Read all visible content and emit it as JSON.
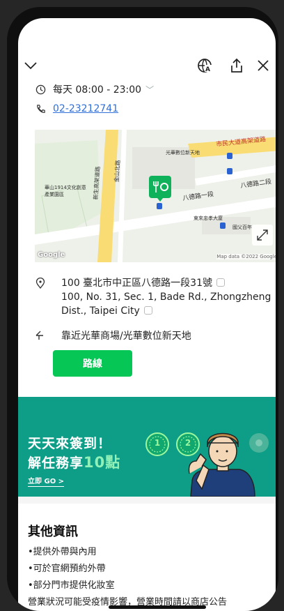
{
  "hours": {
    "label": "每天 08:00 - 23:00"
  },
  "phone": {
    "number": "02-23212741"
  },
  "map": {
    "attribution": "Map data ©2022 Google",
    "google": "Google",
    "labels": {
      "building": "光華數位新天地",
      "park": "華山1914文化創意產業園區",
      "road1": "八德路一段",
      "road2": "八德路二段",
      "ring": "市民大道高架道路",
      "east_st": "東來忠孝大廈",
      "memorial": "國父百年",
      "v_road1": "新生高架道路",
      "v_road2": "金山北路"
    }
  },
  "address": {
    "zh": "100 臺北市中正區八德路一段31號",
    "en": "100, No. 31, Sec. 1, Bade Rd., Zhongzheng Dist., Taipei City"
  },
  "nearby": {
    "text": "靠近光華商場/光華數位新天地"
  },
  "route_button": {
    "label": "路線"
  },
  "banner": {
    "line1": "天天來簽到！",
    "line2_prefix": "解任務享",
    "line2_highlight": "10點",
    "cta": "立即 GO >",
    "coin1": "1",
    "coin2": "2"
  },
  "other_info": {
    "title": "其他資訊",
    "items": [
      "•提供外帶與內用",
      "•可於官網預約外帶",
      "•部分門市提供化妝室",
      "營業狀況可能受疫情影響，營業時間請以商店公告"
    ]
  }
}
